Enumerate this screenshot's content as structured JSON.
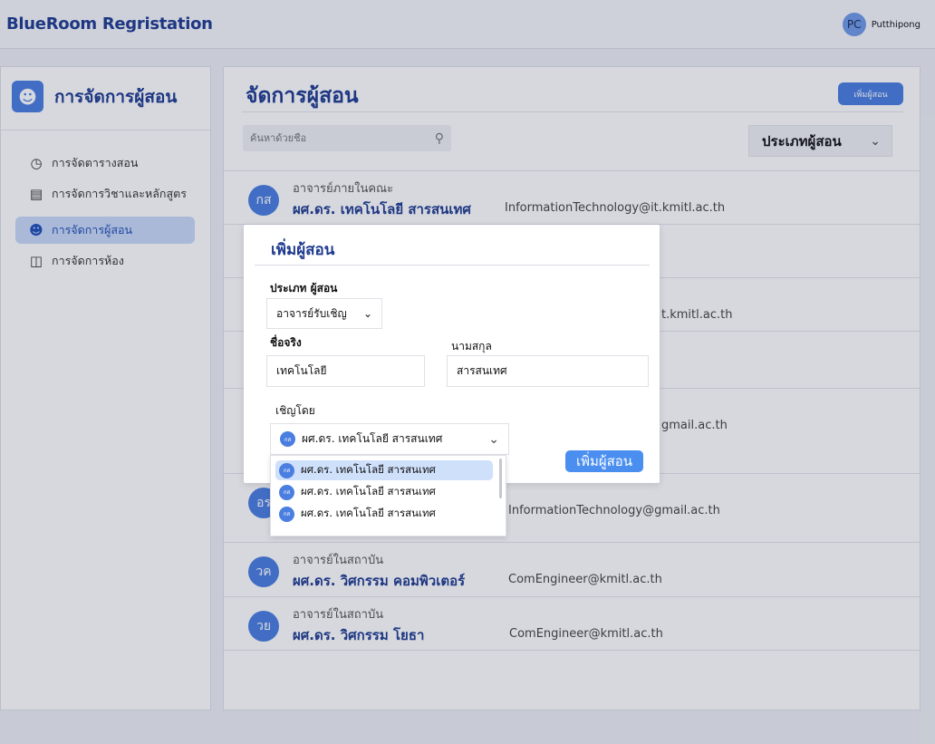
{
  "app": {
    "brand": "BlueRoom Regristation"
  },
  "user": {
    "initials": "PC",
    "name": "Putthipong"
  },
  "sidebar": {
    "title": "การจัดการผู้สอน",
    "items": [
      {
        "label": "การจัดตารางสอน",
        "icon": "schedule-icon"
      },
      {
        "label": "การจัดการวิชาและหลักสูตร",
        "icon": "course-icon"
      },
      {
        "label": "การจัดการผู้สอน",
        "icon": "teachers-icon",
        "active": true
      },
      {
        "label": "การจัดการห้อง",
        "icon": "door-icon"
      }
    ]
  },
  "main": {
    "title": "จัดการผู้สอน",
    "add_button": "เพิ่มผู้สอน",
    "search_placeholder": "ค้นหาด้วยชื่อ",
    "type_filter": "ประเภทผู้สอน",
    "rows": [
      {
        "initials": "กส",
        "role": "อาจารย์ภายในคณะ",
        "name": "ผศ.ดร. เทคโนโลยี สารสนเทศ",
        "email": "InformationTechnology@it.kmitl.ac.th"
      },
      {
        "initials": "",
        "role": "",
        "name": "",
        "email": ""
      },
      {
        "initials": "",
        "role": "",
        "name": "",
        "email": "t.kmitl.ac.th"
      },
      {
        "initials": "",
        "role": "",
        "name": "",
        "email": ""
      },
      {
        "initials": "",
        "role": "",
        "name": "",
        "email": "gmail.ac.th"
      },
      {
        "initials": "อร",
        "role": "",
        "name": "",
        "email": "InformationTechnology@gmail.ac.th"
      },
      {
        "initials": "วค",
        "role": "อาจารย์ในสถาบัน",
        "name": "ผศ.ดร. วิศกรรม คอมพิวเตอร์",
        "email": "ComEngineer@kmitl.ac.th"
      },
      {
        "initials": "วย",
        "role": "อาจารย์ในสถาบัน",
        "name": "ผศ.ดร. วิศกรรม โยธา",
        "email": "ComEngineer@kmitl.ac.th"
      }
    ]
  },
  "modal": {
    "title": "เพิ่มผู้สอน",
    "type_label": "ประเภท ผู้สอน",
    "type_value": "อาจารย์รับเชิญ",
    "firstname_label": "ชื่อจริง",
    "firstname_value": "เทคโนโลยี",
    "lastname_label": "นามสกุล",
    "lastname_value": "สารสนเทศ",
    "invited_label": "เชิญโดย",
    "invited_value": "ผศ.ดร. เทคโนโลยี สารสนเทศ",
    "invited_initials": "กส",
    "submit": "เพิ่มผู้สอน",
    "options": [
      {
        "initials": "กส",
        "label": "ผศ.ดร. เทคโนโลยี สารสนเทศ",
        "selected": true
      },
      {
        "initials": "กส",
        "label": "ผศ.ดร. เทคโนโลยี สารสนเทศ"
      },
      {
        "initials": "กส",
        "label": "ผศ.ดร. เทคโนโลยี สารสนเทศ"
      }
    ]
  },
  "colors": {
    "brand": "#1f3b8f",
    "accent": "#4a7ee0",
    "active_bg": "#c9d9f7"
  }
}
